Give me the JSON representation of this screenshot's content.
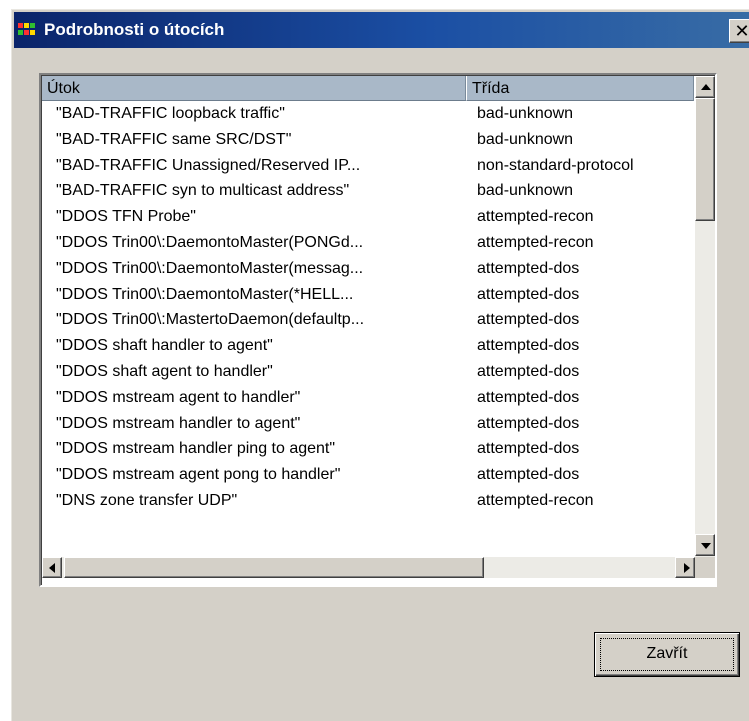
{
  "window": {
    "title": "Podrobnosti o útocích",
    "close_glyph": "✕"
  },
  "list": {
    "columns": [
      "Útok",
      "Třída"
    ],
    "rows": [
      [
        "\"BAD-TRAFFIC loopback traffic\"",
        "bad-unknown"
      ],
      [
        "\"BAD-TRAFFIC same SRC/DST\"",
        "bad-unknown"
      ],
      [
        "\"BAD-TRAFFIC Unassigned/Reserved IP...",
        "non-standard-protocol"
      ],
      [
        "\"BAD-TRAFFIC syn to multicast address\"",
        "bad-unknown"
      ],
      [
        "\"DDOS TFN Probe\"",
        "attempted-recon"
      ],
      [
        "\"DDOS Trin00\\:DaemontoMaster(PONGd...",
        "attempted-recon"
      ],
      [
        "\"DDOS Trin00\\:DaemontoMaster(messag...",
        "attempted-dos"
      ],
      [
        "\"DDOS Trin00\\:DaemontoMaster(*HELL...",
        "attempted-dos"
      ],
      [
        "\"DDOS Trin00\\:MastertoDaemon(defaultp...",
        "attempted-dos"
      ],
      [
        "\"DDOS shaft handler to agent\"",
        "attempted-dos"
      ],
      [
        "\"DDOS shaft agent to handler\"",
        "attempted-dos"
      ],
      [
        "\"DDOS mstream agent to handler\"",
        "attempted-dos"
      ],
      [
        "\"DDOS mstream handler to agent\"",
        "attempted-dos"
      ],
      [
        "\"DDOS mstream handler ping to agent\"",
        "attempted-dos"
      ],
      [
        "\"DDOS mstream agent pong to handler\"",
        "attempted-dos"
      ],
      [
        "\"DNS zone transfer UDP\"",
        "attempted-recon"
      ]
    ]
  },
  "buttons": {
    "close_label": "Zavřít"
  },
  "colors": {
    "titlebar": "#0a246a",
    "dialog_bg": "#d4d0c8",
    "header_bg": "#a9b8c8"
  }
}
